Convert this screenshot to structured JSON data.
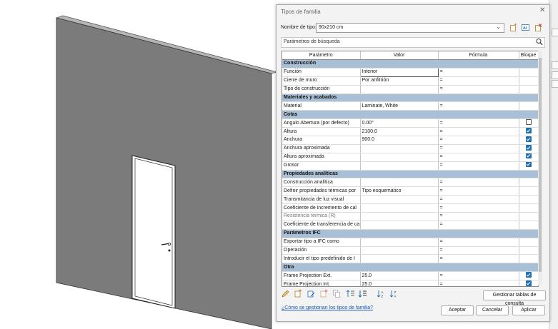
{
  "dialog": {
    "title": "Tipos de familia",
    "close_label": "✕",
    "type_name_label": "Nombre de tipo:",
    "type_name_value": "90x210 cm",
    "search_placeholder": "Parámetros de búsqueda",
    "help_link": "¿Cómo se gestionan los tipos de familia?",
    "lookup_tables_button": "Gestionar tablas de consulta",
    "accept_button": "Aceptar",
    "cancel_button": "Cancelar",
    "apply_button": "Aplicar"
  },
  "table": {
    "columns": [
      "Parámetro",
      "Valor",
      "Fórmula",
      "Bloque"
    ],
    "rows": [
      {
        "group": "Construcción"
      },
      {
        "name": "Función",
        "value": "Interior",
        "formula": "=",
        "lock": null,
        "editing": true
      },
      {
        "name": "Cierre de muro",
        "value": "Por anfitrión",
        "formula": "=",
        "lock": null
      },
      {
        "name": "Tipo de construcción",
        "value": "",
        "formula": "=",
        "lock": null
      },
      {
        "group": "Materiales y acabados"
      },
      {
        "name": "Material",
        "value": "Laminate, White",
        "formula": "=",
        "lock": null
      },
      {
        "group": "Cotas"
      },
      {
        "name": "Angulo Abertura (por defecto)",
        "value": "0.00°",
        "formula": "=",
        "lock": false
      },
      {
        "name": "Altura",
        "value": "2100.0",
        "formula": "=",
        "lock": true
      },
      {
        "name": "Anchura",
        "value": "900.0",
        "formula": "=",
        "lock": true
      },
      {
        "name": "Anchura aproximada",
        "value": "",
        "formula": "=",
        "lock": true
      },
      {
        "name": "Altura aproximada",
        "value": "",
        "formula": "=",
        "lock": true
      },
      {
        "name": "Grosor",
        "value": "",
        "formula": "=",
        "lock": true
      },
      {
        "group": "Propiedades analíticas"
      },
      {
        "name": "Construcción analítica",
        "value": "",
        "formula": "=",
        "lock": null
      },
      {
        "name": "Definir propiedades térmicas por",
        "value": "Tipo esquemático",
        "formula": "=",
        "lock": null
      },
      {
        "name": "Transmitancia de luz visual",
        "value": "",
        "formula": "=",
        "lock": null
      },
      {
        "name": "Coeficiente de incremento de cal",
        "value": "",
        "formula": "=",
        "lock": null
      },
      {
        "name": "Resistencia térmica (R)",
        "value": "",
        "formula": "=",
        "lock": null,
        "disabled": true
      },
      {
        "name": "Coeficiente de transferencia de ca",
        "value": "",
        "formula": "=",
        "lock": null
      },
      {
        "group": "Parámetros IFC"
      },
      {
        "name": "Exportar tipo a IFC como",
        "value": "",
        "formula": "=",
        "lock": null
      },
      {
        "name": "Operación",
        "value": "",
        "formula": "=",
        "lock": null
      },
      {
        "name": "Introducir el tipo predefinido de I",
        "value": "",
        "formula": "=",
        "lock": null
      },
      {
        "group": "Otra"
      },
      {
        "name": "Frame Projection Ext.",
        "value": "25.0",
        "formula": "=",
        "lock": true
      },
      {
        "name": "Frame Projection Int.",
        "value": "25.0",
        "formula": "=",
        "lock": true
      }
    ]
  },
  "icons": {
    "new_type": "new-type-icon",
    "rename_type": "rename-type-icon",
    "delete_type": "delete-type-icon",
    "search": "search-icon"
  },
  "toolbar_icons": [
    "pencil-icon",
    "new-parameter-icon",
    "edit-parameter-icon",
    "delete-parameter-icon",
    "copy-parameter-icon",
    "move-up-icon",
    "move-down-icon",
    "sort-ascending-icon",
    "sort-descending-icon"
  ],
  "colors": {
    "group_header": "#a9bfd6",
    "wall": "#7a7a7a",
    "accent": "#1f6fb2",
    "link": "#1a55b5"
  }
}
